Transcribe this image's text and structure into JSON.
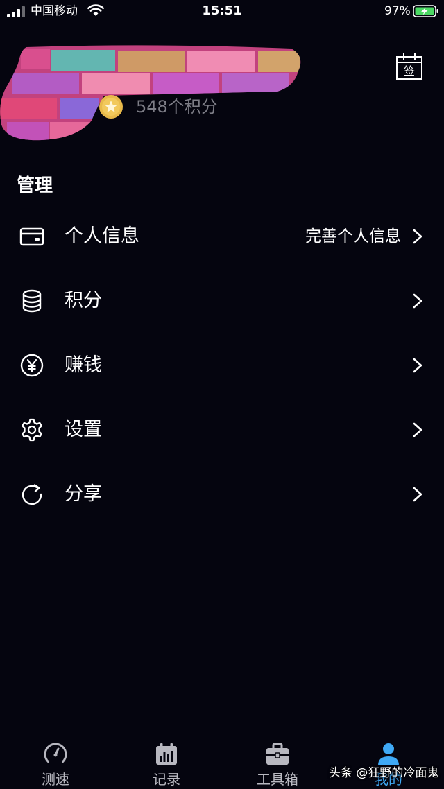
{
  "status_bar": {
    "carrier": "中国移动",
    "time": "15:51",
    "battery": "97%"
  },
  "profile": {
    "points": "548个积分",
    "checkin_label": "签"
  },
  "section": {
    "title": "管理"
  },
  "menu": {
    "items": [
      {
        "label": "个人信息",
        "detail": "完善个人信息",
        "icon": "card-icon"
      },
      {
        "label": "积分",
        "detail": "",
        "icon": "database-icon"
      },
      {
        "label": "赚钱",
        "detail": "",
        "icon": "yen-icon"
      },
      {
        "label": "设置",
        "detail": "",
        "icon": "gear-icon"
      },
      {
        "label": "分享",
        "detail": "",
        "icon": "refresh-share-icon"
      }
    ]
  },
  "tabs": [
    {
      "label": "测速",
      "icon": "speedometer-icon",
      "active": false
    },
    {
      "label": "记录",
      "icon": "calendar-chart-icon",
      "active": false
    },
    {
      "label": "工具箱",
      "icon": "toolbox-icon",
      "active": false
    },
    {
      "label": "我的",
      "icon": "user-icon",
      "active": true
    }
  ],
  "watermark": "头条 @狂野的冷面鬼",
  "colors": {
    "background": "#05050f",
    "accent": "#3fa9f5",
    "muted_text": "#7d7d86",
    "battery_green": "#4cd964",
    "coin_gold": "#e8b94a"
  }
}
